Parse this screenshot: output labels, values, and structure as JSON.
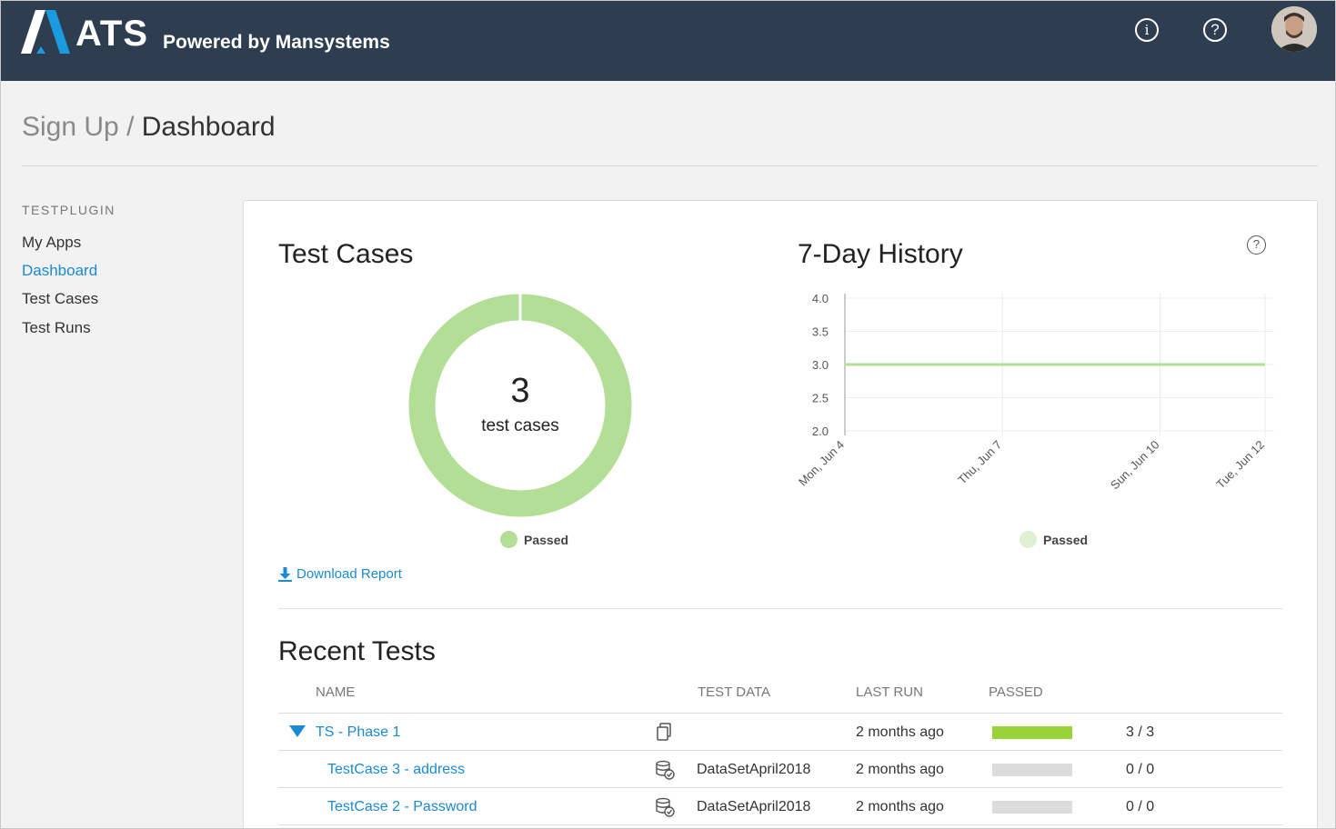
{
  "header": {
    "brand": "ATS",
    "tagline": "Powered by Mansystems",
    "info_icon": "info-icon",
    "help_icon": "help-icon"
  },
  "breadcrumb": {
    "parent": "Sign Up",
    "separator": " / ",
    "current": "Dashboard"
  },
  "sidebar": {
    "title": "TESTPLUGIN",
    "items": [
      {
        "label": "My Apps",
        "active": false
      },
      {
        "label": "Dashboard",
        "active": true
      },
      {
        "label": "Test Cases",
        "active": false
      },
      {
        "label": "Test Runs",
        "active": false
      }
    ]
  },
  "test_cases": {
    "title": "Test Cases",
    "count": "3",
    "count_label": "test cases",
    "legend": "Passed",
    "download_label": "Download Report"
  },
  "history": {
    "title": "7-Day History",
    "legend": "Passed"
  },
  "chart_data": [
    {
      "type": "pie",
      "categories": [
        "Passed"
      ],
      "values": [
        3
      ],
      "colors": [
        "#b3de96"
      ]
    },
    {
      "type": "line",
      "x": [
        "Mon, Jun 4",
        "Thu, Jun 7",
        "Sun, Jun 10",
        "Tue, Jun 12"
      ],
      "series": [
        {
          "name": "Passed",
          "values": [
            3.0,
            3.0,
            3.0,
            3.0
          ]
        }
      ],
      "yticks": [
        "4.0",
        "3.5",
        "3.0",
        "2.5",
        "2.0"
      ],
      "ylim": [
        2.0,
        4.0
      ],
      "grid": true,
      "color": "#b3de96"
    }
  ],
  "recent_tests": {
    "title": "Recent Tests",
    "columns": [
      "NAME",
      "TEST DATA",
      "LAST RUN",
      "PASSED"
    ],
    "rows": [
      {
        "name": "TS - Phase 1",
        "test_data": "",
        "last_run": "2 months ago",
        "passed": "3 / 3",
        "pass_fraction": 1.0,
        "icon": "copy-icon"
      },
      {
        "name": "TestCase 3 - address",
        "test_data": "DataSetApril2018",
        "last_run": "2 months ago",
        "passed": "0 / 0",
        "pass_fraction": 0,
        "icon": "dataset-icon"
      },
      {
        "name": "TestCase 2 - Password",
        "test_data": "DataSetApril2018",
        "last_run": "2 months ago",
        "passed": "0 / 0",
        "pass_fraction": 0,
        "icon": "dataset-icon"
      }
    ]
  },
  "colors": {
    "header_bg": "#2e3e50",
    "link": "#1a8ad2",
    "passed": "#b3de96",
    "bar_full": "#9ad23a",
    "bar_empty": "#dcdcdc"
  }
}
